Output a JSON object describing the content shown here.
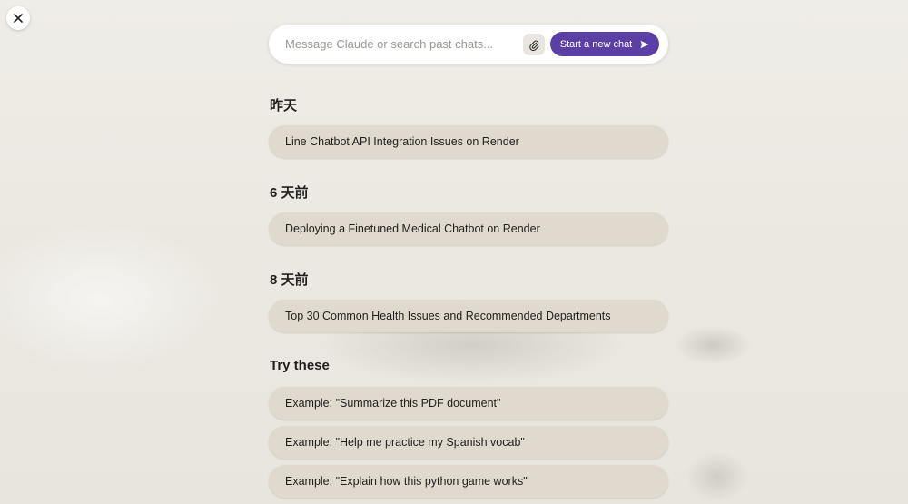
{
  "close_button": {
    "icon": "close-icon"
  },
  "composer": {
    "placeholder": "Message Claude or search past chats...",
    "attach_icon": "paperclip-icon",
    "start_button_label": "Start a new chat",
    "start_button_icon": "send-icon",
    "accent_color": "#5b3fa5"
  },
  "sections": [
    {
      "heading": "昨天",
      "chats": [
        "Line Chatbot API Integration Issues on Render"
      ]
    },
    {
      "heading": "6 天前",
      "chats": [
        "Deploying a Finetuned Medical Chatbot on Render"
      ]
    },
    {
      "heading": "8 天前",
      "chats": [
        "Top 30 Common Health Issues and Recommended Departments"
      ]
    }
  ],
  "try_these": {
    "heading": "Try these",
    "examples": [
      "Example: \"Summarize this PDF document\"",
      "Example: \"Help me practice my Spanish vocab\"",
      "Example: \"Explain how this python game works\""
    ]
  }
}
